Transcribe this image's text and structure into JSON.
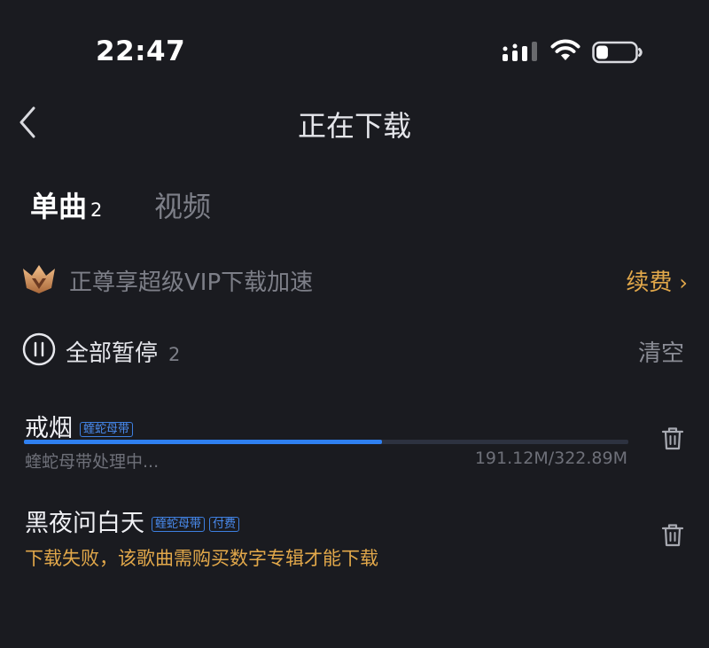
{
  "status_bar": {
    "time": "22:47",
    "signal_icon": "cellular-signal-icon",
    "wifi_icon": "wifi-icon",
    "battery_icon": "battery-icon",
    "battery_level": 0.3
  },
  "header": {
    "back_icon": "chevron-left-icon",
    "title": "正在下载"
  },
  "tabs": [
    {
      "label": "单曲",
      "count": "2",
      "active": true
    },
    {
      "label": "视频",
      "count": "",
      "active": false
    }
  ],
  "vip": {
    "icon": "crown-icon",
    "text": "正尊享超级VIP下载加速",
    "renew_label": "续费",
    "renew_chevron": "›"
  },
  "controls": {
    "pause_icon": "pause-circle-icon",
    "pause_all_label": "全部暂停",
    "pause_all_count": "2",
    "clear_label": "清空"
  },
  "downloads": [
    {
      "title": "戒烟",
      "tags": [
        "蝰蛇母带"
      ],
      "progress": 0.592,
      "status": "蝰蛇母带处理中...",
      "size": "191.12M/322.89M"
    },
    {
      "title": "黑夜问白天",
      "tags": [
        "蝰蛇母带",
        "付费"
      ],
      "status": "下载失败，该歌曲需购买数字专辑才能下载"
    }
  ],
  "colors": {
    "background": "#1a1b20",
    "accent_blue": "#2f80f0",
    "accent_gold": "#e2a84a"
  }
}
